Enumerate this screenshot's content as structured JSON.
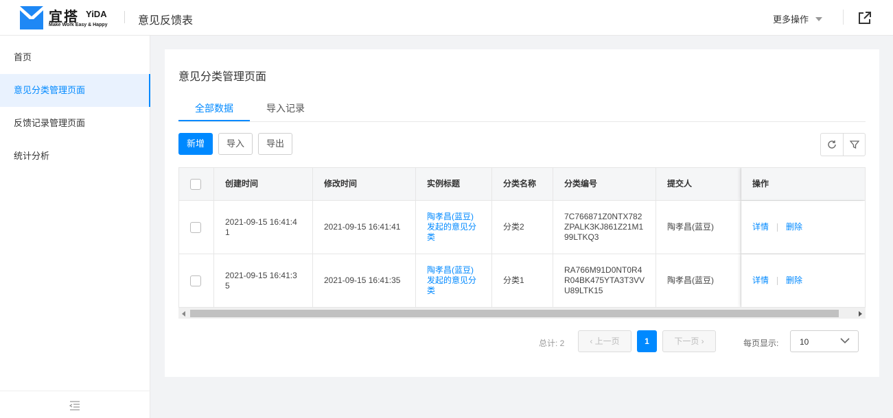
{
  "header": {
    "brand_cn": "宜搭",
    "brand_en": "YiDA",
    "slogan": "Make Work Easy & Happy",
    "app_title": "意见反馈表",
    "more_ops": "更多操作"
  },
  "sidebar": {
    "items": [
      {
        "label": "首页"
      },
      {
        "label": "意见分类管理页面"
      },
      {
        "label": "反馈记录管理页面"
      },
      {
        "label": "统计分析"
      }
    ]
  },
  "main": {
    "page_title": "意见分类管理页面",
    "tabs": [
      {
        "label": "全部数据"
      },
      {
        "label": "导入记录"
      }
    ],
    "buttons": {
      "add": "新增",
      "import": "导入",
      "export": "导出"
    },
    "table": {
      "headers": {
        "created": "创建时间",
        "modified": "修改时间",
        "title": "实例标题",
        "category_name": "分类名称",
        "category_code": "分类编号",
        "submitter": "提交人",
        "actions": "操作"
      },
      "rows": [
        {
          "created": "2021-09-15 16:41:41",
          "modified": "2021-09-15 16:41:41",
          "title": "陶孝昌(蓝豆)发起的意见分类",
          "category_name": "分类2",
          "category_code": "7C766871Z0NTX782ZPALK3KJ861Z21M199LTKQ3",
          "submitter": "陶孝昌(蓝豆)",
          "detail": "详情",
          "delete": "删除"
        },
        {
          "created": "2021-09-15 16:41:35",
          "modified": "2021-09-15 16:41:35",
          "title": "陶孝昌(蓝豆)发起的意见分类",
          "category_name": "分类1",
          "category_code": "RA766M91D0NT0R4R04BK475YTA3T3VVU89LTK15",
          "submitter": "陶孝昌(蓝豆)",
          "detail": "详情",
          "delete": "删除"
        }
      ]
    },
    "pagination": {
      "total": "总计: 2",
      "prev": "上一页",
      "next": "下一页",
      "current": "1",
      "per_page_label": "每页显示:",
      "per_page_value": "10"
    }
  },
  "colors": {
    "accent": "#0089ff",
    "logo": "#1e88f5"
  }
}
